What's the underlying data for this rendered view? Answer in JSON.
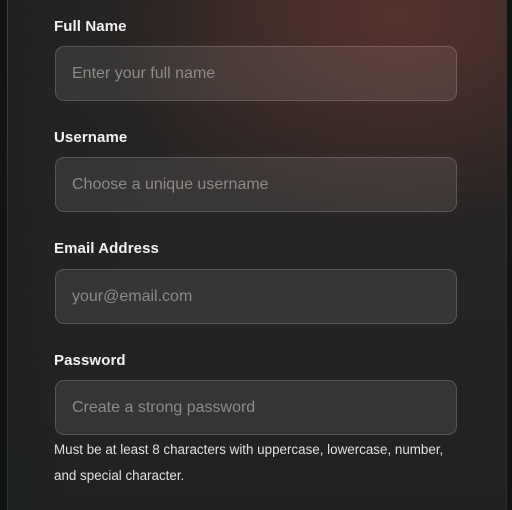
{
  "form": {
    "full_name": {
      "label": "Full Name",
      "placeholder": "Enter your full name",
      "value": ""
    },
    "username": {
      "label": "Username",
      "placeholder": "Choose a unique username",
      "value": ""
    },
    "email": {
      "label": "Email Address",
      "placeholder": "your@email.com",
      "value": ""
    },
    "password": {
      "label": "Password",
      "placeholder": "Create a strong password",
      "value": "",
      "hint": "Must be at least 8 characters with uppercase, lowercase, number, and special character."
    }
  },
  "colors": {
    "background": "#121414",
    "card_top": "#2d2725",
    "card_accent": "#5c342e",
    "label_text": "#f4f2f0",
    "placeholder_text": "#8d8a88"
  }
}
